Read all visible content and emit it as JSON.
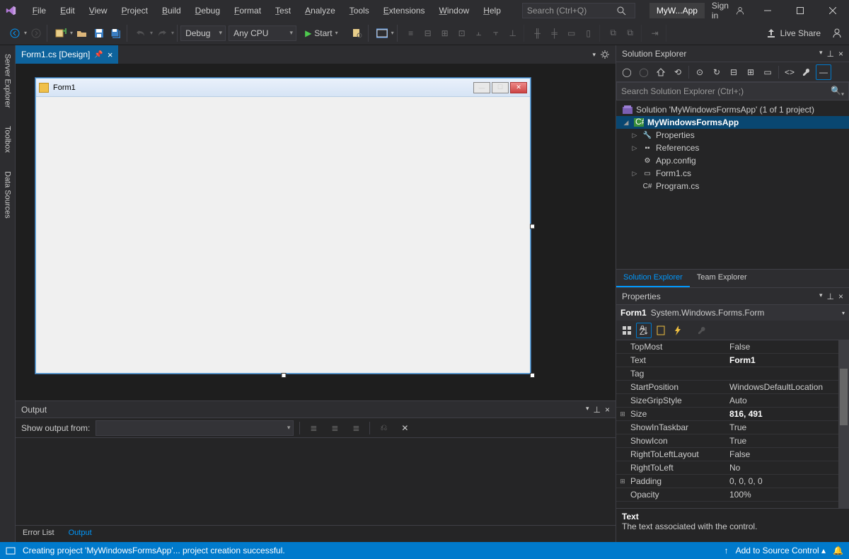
{
  "menu": [
    "File",
    "Edit",
    "View",
    "Project",
    "Build",
    "Debug",
    "Format",
    "Test",
    "Analyze",
    "Tools",
    "Extensions",
    "Window",
    "Help"
  ],
  "search_placeholder": "Search (Ctrl+Q)",
  "app_title": "MyW...App",
  "sign_in": "Sign in",
  "toolbar": {
    "config": "Debug",
    "platform": "Any CPU",
    "start": "Start",
    "live_share": "Live Share"
  },
  "left_tabs": [
    "Server Explorer",
    "Toolbox",
    "Data Sources"
  ],
  "doc_tab": "Form1.cs [Design]",
  "form": {
    "title": "Form1"
  },
  "output": {
    "title": "Output",
    "show_from": "Show output from:",
    "tabs": [
      "Error List",
      "Output"
    ]
  },
  "solution_explorer": {
    "title": "Solution Explorer",
    "search_placeholder": "Search Solution Explorer (Ctrl+;)",
    "root": "Solution 'MyWindowsFormsApp' (1 of 1 project)",
    "project": "MyWindowsFormsApp",
    "nodes": [
      "Properties",
      "References",
      "App.config",
      "Form1.cs",
      "Program.cs"
    ],
    "tabs": [
      "Solution Explorer",
      "Team Explorer"
    ]
  },
  "properties": {
    "title": "Properties",
    "object_name": "Form1",
    "object_type": "System.Windows.Forms.Form",
    "rows": [
      {
        "exp": "",
        "name": "Opacity",
        "val": "100%",
        "bold": false
      },
      {
        "exp": "⊞",
        "name": "Padding",
        "val": "0, 0, 0, 0",
        "bold": false
      },
      {
        "exp": "",
        "name": "RightToLeft",
        "val": "No",
        "bold": false
      },
      {
        "exp": "",
        "name": "RightToLeftLayout",
        "val": "False",
        "bold": false
      },
      {
        "exp": "",
        "name": "ShowIcon",
        "val": "True",
        "bold": false
      },
      {
        "exp": "",
        "name": "ShowInTaskbar",
        "val": "True",
        "bold": false
      },
      {
        "exp": "⊞",
        "name": "Size",
        "val": "816, 491",
        "bold": true
      },
      {
        "exp": "",
        "name": "SizeGripStyle",
        "val": "Auto",
        "bold": false
      },
      {
        "exp": "",
        "name": "StartPosition",
        "val": "WindowsDefaultLocation",
        "bold": false
      },
      {
        "exp": "",
        "name": "Tag",
        "val": "",
        "bold": false
      },
      {
        "exp": "",
        "name": "Text",
        "val": "Form1",
        "bold": true
      },
      {
        "exp": "",
        "name": "TopMost",
        "val": "False",
        "bold": false
      }
    ],
    "desc_title": "Text",
    "desc_body": "The text associated with the control."
  },
  "status": {
    "msg": "Creating project 'MyWindowsFormsApp'... project creation successful.",
    "source_control": "Add to Source Control"
  }
}
